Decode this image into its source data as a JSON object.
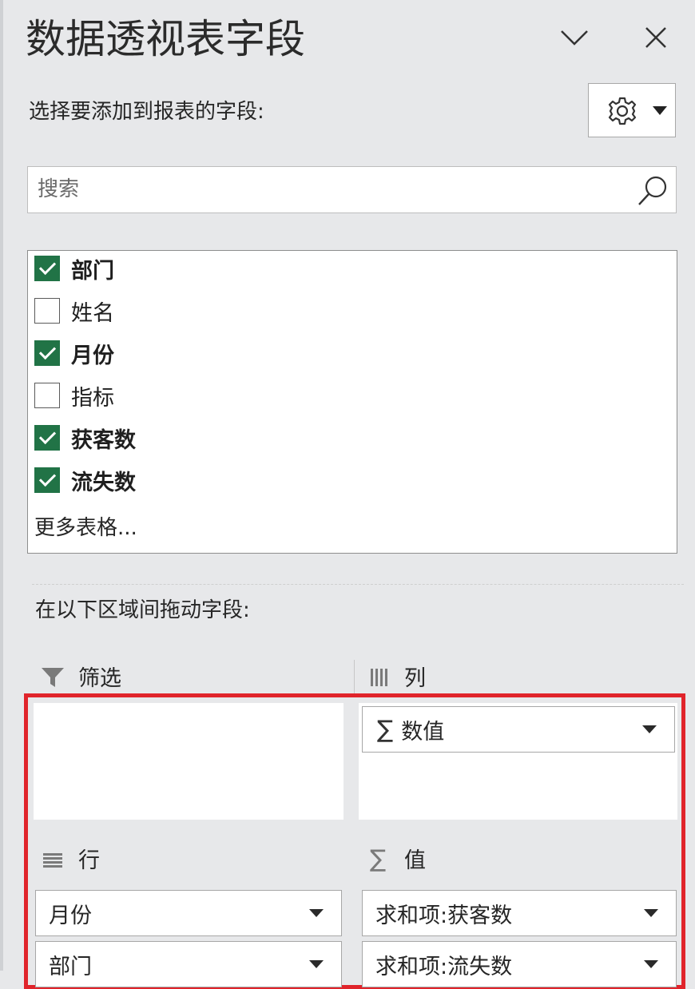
{
  "panel": {
    "title": "数据透视表字段",
    "collapse_icon": "chevron-down-icon",
    "close_icon": "close-icon"
  },
  "fields_section": {
    "prompt": "选择要添加到报表的字段:",
    "settings_icon": "gear-icon",
    "search_placeholder": "搜索",
    "fields": [
      {
        "label": "部门",
        "checked": true
      },
      {
        "label": "姓名",
        "checked": false
      },
      {
        "label": "月份",
        "checked": true
      },
      {
        "label": "指标",
        "checked": false
      },
      {
        "label": "获客数",
        "checked": true
      },
      {
        "label": "流失数",
        "checked": true
      }
    ],
    "more_tables": "更多表格..."
  },
  "areas_section": {
    "prompt": "在以下区域间拖动字段:",
    "filter": {
      "label": "筛选",
      "items": []
    },
    "columns": {
      "label": "列",
      "items": [
        {
          "label": "数值",
          "sigma": true
        }
      ]
    },
    "rows": {
      "label": "行",
      "items": [
        {
          "label": "月份"
        },
        {
          "label": "部门"
        }
      ]
    },
    "values": {
      "label": "值",
      "items": [
        {
          "label": "求和项:获客数"
        },
        {
          "label": "求和项:流失数"
        }
      ]
    }
  },
  "colors": {
    "checkbox_checked": "#217346",
    "highlight_border": "#e0242b",
    "panel_background": "#e7e8ea"
  }
}
